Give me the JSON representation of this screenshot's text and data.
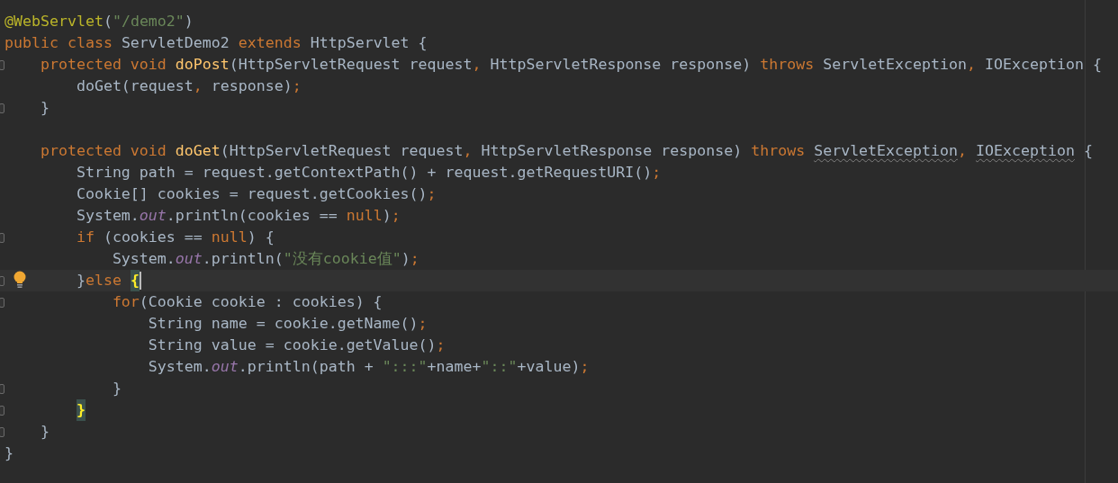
{
  "editor": {
    "lines": [
      {
        "fold": false,
        "current": false,
        "tokens": [
          {
            "kind": "annotation",
            "text": "@WebServlet"
          },
          {
            "kind": "plain",
            "text": "("
          },
          {
            "kind": "string",
            "text": "\"/demo2\""
          },
          {
            "kind": "plain",
            "text": ")"
          }
        ]
      },
      {
        "fold": false,
        "current": false,
        "tokens": [
          {
            "kind": "keyword",
            "text": "public class"
          },
          {
            "kind": "plain",
            "text": " ServletDemo2 "
          },
          {
            "kind": "keyword",
            "text": "extends"
          },
          {
            "kind": "plain",
            "text": " HttpServlet {"
          }
        ]
      },
      {
        "fold": true,
        "current": false,
        "tokens": [
          {
            "kind": "keyword",
            "text": "    protected void "
          },
          {
            "kind": "method",
            "text": "doPost"
          },
          {
            "kind": "plain",
            "text": "(HttpServletRequest request"
          },
          {
            "kind": "punct",
            "text": ","
          },
          {
            "kind": "plain",
            "text": " HttpServletResponse response) "
          },
          {
            "kind": "keyword",
            "text": "throws"
          },
          {
            "kind": "plain",
            "text": " ServletException"
          },
          {
            "kind": "punct",
            "text": ","
          },
          {
            "kind": "plain",
            "text": " IOException {"
          }
        ]
      },
      {
        "fold": false,
        "current": false,
        "tokens": [
          {
            "kind": "plain",
            "text": "        doGet(request"
          },
          {
            "kind": "punct",
            "text": ","
          },
          {
            "kind": "plain",
            "text": " response)"
          },
          {
            "kind": "punct",
            "text": ";"
          }
        ]
      },
      {
        "fold": true,
        "current": false,
        "tokens": [
          {
            "kind": "plain",
            "text": "    }"
          }
        ]
      },
      {
        "fold": false,
        "current": false
      },
      {
        "fold": false,
        "current": false,
        "tokens": [
          {
            "kind": "keyword",
            "text": "    protected void "
          },
          {
            "kind": "method",
            "text": "doGet"
          },
          {
            "kind": "plain",
            "text": "(HttpServletRequest request"
          },
          {
            "kind": "punct",
            "text": ","
          },
          {
            "kind": "plain",
            "text": " HttpServletResponse response) "
          },
          {
            "kind": "keyword",
            "text": "throws "
          },
          {
            "kind": "warned",
            "text": "ServletException"
          },
          {
            "kind": "punct",
            "text": ", "
          },
          {
            "kind": "warned",
            "text": "IOException"
          },
          {
            "kind": "plain",
            "text": " {"
          }
        ]
      },
      {
        "fold": false,
        "current": false,
        "tokens": [
          {
            "kind": "plain",
            "text": "        String path = request.getContextPath() + request.getRequestURI()"
          },
          {
            "kind": "punct",
            "text": ";"
          }
        ]
      },
      {
        "fold": false,
        "current": false,
        "tokens": [
          {
            "kind": "plain",
            "text": "        Cookie[] cookies = request.getCookies()"
          },
          {
            "kind": "punct",
            "text": ";"
          }
        ]
      },
      {
        "fold": false,
        "current": false,
        "tokens": [
          {
            "kind": "plain",
            "text": "        System."
          },
          {
            "kind": "static",
            "text": "out"
          },
          {
            "kind": "plain",
            "text": ".println(cookies == "
          },
          {
            "kind": "keyword",
            "text": "null"
          },
          {
            "kind": "plain",
            "text": ")"
          },
          {
            "kind": "punct",
            "text": ";"
          }
        ]
      },
      {
        "fold": true,
        "current": false,
        "tokens": [
          {
            "kind": "keyword",
            "text": "        if"
          },
          {
            "kind": "plain",
            "text": " (cookies == "
          },
          {
            "kind": "keyword",
            "text": "null"
          },
          {
            "kind": "plain",
            "text": ") {"
          }
        ]
      },
      {
        "fold": false,
        "current": false,
        "tokens": [
          {
            "kind": "plain",
            "text": "            System."
          },
          {
            "kind": "static",
            "text": "out"
          },
          {
            "kind": "plain",
            "text": ".println("
          },
          {
            "kind": "string",
            "text": "\"没有cookie值\""
          },
          {
            "kind": "plain",
            "text": ")"
          },
          {
            "kind": "punct",
            "text": ";"
          }
        ]
      },
      {
        "fold": true,
        "current": true,
        "tokens": [
          {
            "kind": "plain",
            "text": "        }"
          },
          {
            "kind": "keyword",
            "text": "else "
          },
          {
            "kind": "matched",
            "text": "{"
          }
        ]
      },
      {
        "fold": true,
        "current": false,
        "tokens": [
          {
            "kind": "keyword",
            "text": "            for"
          },
          {
            "kind": "plain",
            "text": "(Cookie cookie : cookies) {"
          }
        ]
      },
      {
        "fold": false,
        "current": false,
        "tokens": [
          {
            "kind": "plain",
            "text": "                String name = cookie.getName()"
          },
          {
            "kind": "punct",
            "text": ";"
          }
        ]
      },
      {
        "fold": false,
        "current": false,
        "tokens": [
          {
            "kind": "plain",
            "text": "                String value = cookie.getValue()"
          },
          {
            "kind": "punct",
            "text": ";"
          }
        ]
      },
      {
        "fold": false,
        "current": false,
        "tokens": [
          {
            "kind": "plain",
            "text": "                System."
          },
          {
            "kind": "static",
            "text": "out"
          },
          {
            "kind": "plain",
            "text": ".println(path + "
          },
          {
            "kind": "string",
            "text": "\":::\""
          },
          {
            "kind": "plain",
            "text": "+name+"
          },
          {
            "kind": "string",
            "text": "\"::\""
          },
          {
            "kind": "plain",
            "text": "+value)"
          },
          {
            "kind": "punct",
            "text": ";"
          }
        ]
      },
      {
        "fold": true,
        "current": false,
        "tokens": [
          {
            "kind": "plain",
            "text": "            }"
          }
        ]
      },
      {
        "fold": true,
        "current": false,
        "tokens": [
          {
            "kind": "matched",
            "text": "        }"
          }
        ]
      },
      {
        "fold": true,
        "current": false,
        "tokens": [
          {
            "kind": "plain",
            "text": "    }"
          }
        ]
      },
      {
        "fold": false,
        "current": false,
        "tokens": [
          {
            "kind": "plain",
            "text": "}"
          }
        ]
      }
    ]
  }
}
